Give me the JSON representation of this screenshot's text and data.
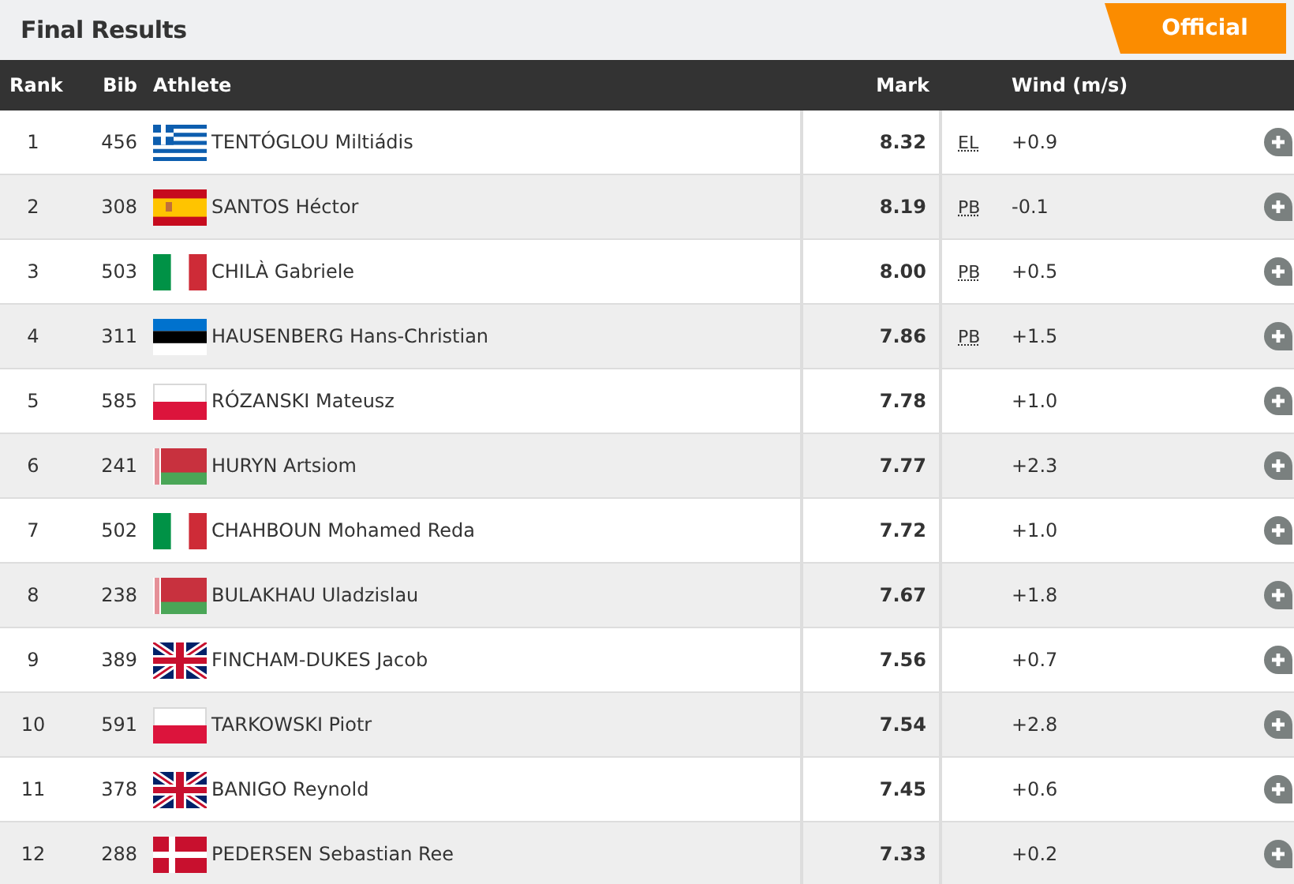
{
  "title": "Final Results",
  "status_badge": "Official",
  "columns": [
    "Rank",
    "Bib",
    "Athlete",
    "Mark",
    "Wind (m/s)"
  ],
  "rows": [
    {
      "rank": "1",
      "bib": "456",
      "kind": "greece",
      "athlete": "TENTÓGLOU Miltiádis",
      "mark": "8.32",
      "record": "EL",
      "wind": "+0.9"
    },
    {
      "rank": "2",
      "bib": "308",
      "kind": "spain",
      "athlete": "SANTOS Héctor",
      "mark": "8.19",
      "record": "PB",
      "wind": "-0.1"
    },
    {
      "rank": "3",
      "bib": "503",
      "kind": "italy",
      "athlete": "CHILÀ Gabriele",
      "mark": "8.00",
      "record": "PB",
      "wind": "+0.5"
    },
    {
      "rank": "4",
      "bib": "311",
      "kind": "estonia",
      "athlete": "HAUSENBERG Hans-Christian",
      "mark": "7.86",
      "record": "PB",
      "wind": "+1.5"
    },
    {
      "rank": "5",
      "bib": "585",
      "kind": "poland",
      "athlete": "RÓZANSKI Mateusz",
      "mark": "7.78",
      "wind": "+1.0"
    },
    {
      "rank": "6",
      "bib": "241",
      "kind": "belarus",
      "athlete": "HURYN Artsiom",
      "mark": "7.77",
      "wind": "+2.3"
    },
    {
      "rank": "7",
      "bib": "502",
      "kind": "italy",
      "athlete": "CHAHBOUN Mohamed Reda",
      "mark": "7.72",
      "wind": "+1.0"
    },
    {
      "rank": "8",
      "bib": "238",
      "kind": "belarus",
      "athlete": "BULAKHAU Uladzislau",
      "mark": "7.67",
      "wind": "+1.8"
    },
    {
      "rank": "9",
      "bib": "389",
      "kind": "uk",
      "athlete": "FINCHAM-DUKES Jacob",
      "mark": "7.56",
      "wind": "+0.7"
    },
    {
      "rank": "10",
      "bib": "591",
      "kind": "poland",
      "athlete": "TARKOWSKI Piotr",
      "mark": "7.54",
      "wind": "+2.8"
    },
    {
      "rank": "11",
      "bib": "378",
      "kind": "uk",
      "athlete": "BANIGO Reynold",
      "mark": "7.45",
      "wind": "+0.6"
    },
    {
      "rank": "12",
      "bib": "288",
      "kind": "denmark",
      "athlete": "PEDERSEN Sebastian Ree",
      "mark": "7.33",
      "wind": "+0.2"
    }
  ]
}
